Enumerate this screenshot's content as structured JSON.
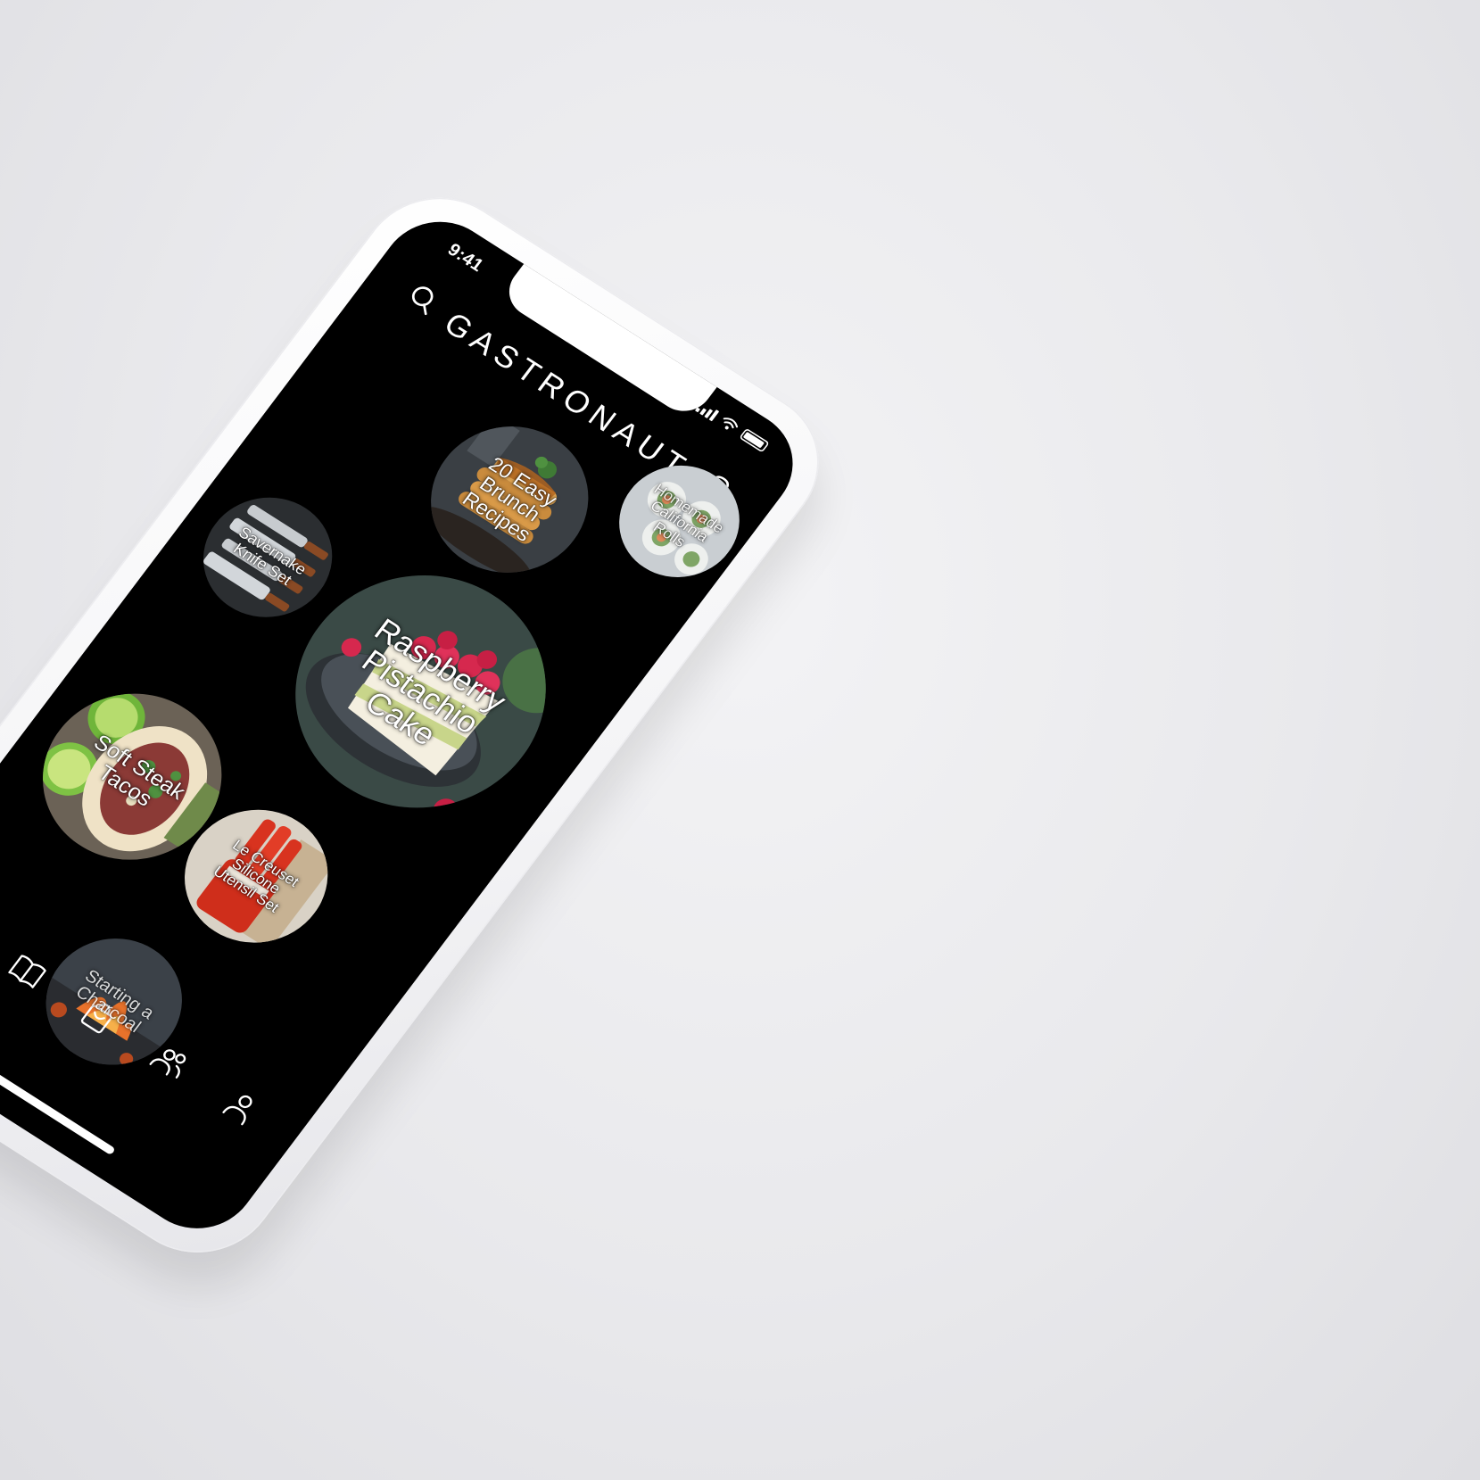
{
  "status_bar": {
    "time": "9:41"
  },
  "header": {
    "title": "GASTRONAUT",
    "search_icon": "search-icon",
    "notification_icon": "bell-icon"
  },
  "feed": {
    "items": [
      {
        "label": "20 Easy\nBrunch\nRecipes",
        "kind": "article",
        "image": "pancake-stack"
      },
      {
        "label": "Homemade\nCalifornia\nRolls",
        "kind": "recipe",
        "image": "sushi-rolls"
      },
      {
        "label": "Raspberry\nPistachio\nCake",
        "kind": "recipe",
        "image": "raspberry-cake"
      },
      {
        "label": "Savernake\nKnife Set",
        "kind": "product",
        "image": "knife-set"
      },
      {
        "label": "Soft Steak\nTacos",
        "kind": "recipe",
        "image": "steak-tacos"
      },
      {
        "label": "Le Creuset\nSilicone\nUtensil Set",
        "kind": "product",
        "image": "red-utensils"
      },
      {
        "label": "Starting a\nCharcoal",
        "kind": "article",
        "image": "charcoal-fire"
      }
    ]
  },
  "tabbar": {
    "tabs": [
      {
        "icon": "home-icon"
      },
      {
        "icon": "book-icon"
      },
      {
        "icon": "shopping-bag-icon"
      },
      {
        "icon": "community-icon"
      },
      {
        "icon": "profile-icon"
      }
    ]
  },
  "colors": {
    "screen_background": "#000000",
    "phone_body": "#f7f7f8",
    "text": "#ffffff"
  }
}
